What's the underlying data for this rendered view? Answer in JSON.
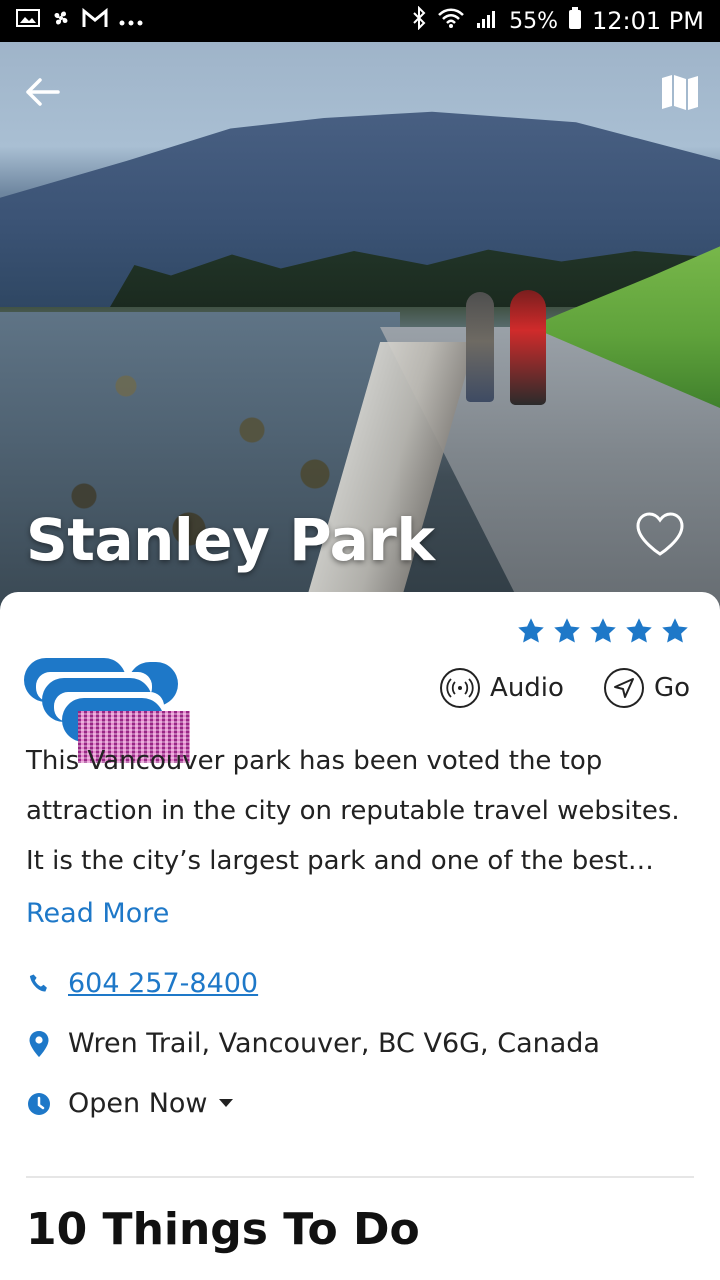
{
  "statusbar": {
    "battery_percent": "55%",
    "time": "12:01 PM",
    "left_icons": [
      "image-icon",
      "fan-icon",
      "gmail-icon",
      "more-dots-icon"
    ]
  },
  "hero": {
    "title": "Stanley Park",
    "back_icon": "arrow-left-icon",
    "map_icon": "map-icon",
    "favorite_icon": "heart-outline-icon"
  },
  "rating": {
    "stars": 5,
    "max": 5,
    "color": "#1e78c8"
  },
  "actions": [
    {
      "label": "Audio",
      "icon": "audio-broadcast-icon"
    },
    {
      "label": "Go",
      "icon": "navigate-arrow-icon"
    }
  ],
  "description": {
    "text": "This Vancouver park has been voted the top attraction in the city on reputable travel websites. It is the city’s largest park and one of the best…",
    "read_more_label": "Read More"
  },
  "info": {
    "phone": "604 257-8400",
    "address": "Wren Trail, Vancouver, BC V6G, Canada",
    "hours_label": "Open Now"
  },
  "section": {
    "title": "10 Things To Do"
  },
  "colors": {
    "accent": "#1e78c8",
    "text": "#222222"
  }
}
